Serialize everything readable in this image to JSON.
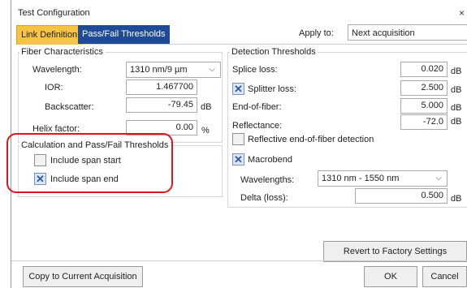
{
  "window": {
    "title": "Test Configuration",
    "close_glyph": "×"
  },
  "tabs": [
    {
      "label": "Link Definition"
    },
    {
      "label": "Pass/Fail Thresholds"
    }
  ],
  "apply_to": {
    "label": "Apply to:",
    "value": "Next acquisition"
  },
  "fiber": {
    "title": "Fiber Characteristics",
    "wavelength_label": "Wavelength:",
    "wavelength_value": "1310 nm/9 µm",
    "ior_label": "IOR:",
    "ior_value": "1.467700",
    "backscatter_label": "Backscatter:",
    "backscatter_value": "-79.45",
    "backscatter_unit": "dB",
    "helix_label": "Helix factor:",
    "helix_value": "0.00",
    "helix_unit": "%"
  },
  "calc": {
    "title": "Calculation and Pass/Fail Thresholds",
    "include_start_label": "Include span start",
    "include_start_checked": false,
    "include_end_label": "Include span end",
    "include_end_checked": true
  },
  "detection": {
    "title": "Detection Thresholds",
    "splice_label": "Splice loss:",
    "splice_value": "0.020",
    "splitter_label": "Splitter loss:",
    "splitter_value": "2.500",
    "eof_label": "End-of-fiber:",
    "eof_value": "5.000",
    "reflectance_label": "Reflectance:",
    "reflectance_value": "-72.0",
    "unit": "dB",
    "reflective_eof_label": "Reflective end-of-fiber detection",
    "macrobend_label": "Macrobend",
    "wavelengths_label": "Wavelengths:",
    "wavelengths_value": "1310 nm - 1550 nm",
    "delta_label": "Delta (loss):",
    "delta_value": "0.500"
  },
  "buttons": {
    "revert": "Revert to Factory Settings",
    "copy": "Copy to Current Acquisition",
    "ok": "OK",
    "cancel": "Cancel"
  },
  "colors": {
    "active_tab": "#f6c343",
    "inactive_tab": "#1e4a96",
    "highlight": "#e0141b",
    "check": "#2a5aa8"
  }
}
